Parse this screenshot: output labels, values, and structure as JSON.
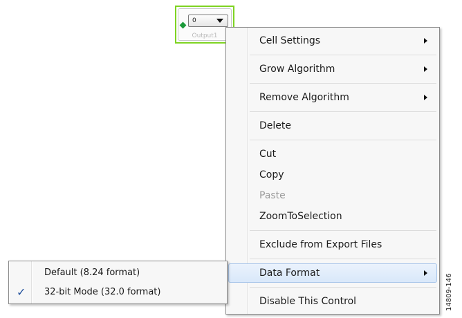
{
  "output_cell": {
    "dropdown_value": "0",
    "label": "Output1",
    "colors": {
      "border": "#7ed321",
      "pin": "#1b9a3a"
    }
  },
  "context_menu": {
    "items": [
      {
        "label": "Cell Settings",
        "has_submenu": true,
        "enabled": true
      },
      {
        "label": "Grow Algorithm",
        "has_submenu": true,
        "enabled": true
      },
      {
        "label": "Remove Algorithm",
        "has_submenu": true,
        "enabled": true
      },
      {
        "label": "Delete",
        "has_submenu": false,
        "enabled": true
      },
      {
        "label": "Cut",
        "has_submenu": false,
        "enabled": true
      },
      {
        "label": "Copy",
        "has_submenu": false,
        "enabled": true
      },
      {
        "label": "Paste",
        "has_submenu": false,
        "enabled": false
      },
      {
        "label": "ZoomToSelection",
        "has_submenu": false,
        "enabled": true
      },
      {
        "label": "Exclude from Export Files",
        "has_submenu": false,
        "enabled": true
      },
      {
        "label": "Data Format",
        "has_submenu": true,
        "enabled": true,
        "highlighted": true
      },
      {
        "label": "Disable This Control",
        "has_submenu": false,
        "enabled": true
      }
    ]
  },
  "data_format_submenu": {
    "items": [
      {
        "label": "Default (8.24 format)",
        "checked": false
      },
      {
        "label": "32-bit Mode (32.0 format)",
        "checked": true
      }
    ],
    "check_glyph": "✓"
  },
  "figure_id": "14809-146",
  "colors": {
    "highlight": "#d9e8fa",
    "disabled_text": "#9a9a9a"
  }
}
